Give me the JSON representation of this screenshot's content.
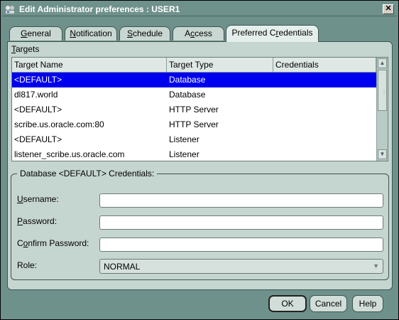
{
  "window": {
    "title": "Edit Administrator preferences : USER1",
    "close_glyph": "✕"
  },
  "tabs": [
    {
      "pre": "",
      "key": "G",
      "post": "eneral"
    },
    {
      "pre": "",
      "key": "N",
      "post": "otification"
    },
    {
      "pre": "",
      "key": "S",
      "post": "chedule"
    },
    {
      "pre": "A",
      "key": "c",
      "post": "cess"
    },
    {
      "pre": "Preferred C",
      "key": "r",
      "post": "edentials"
    }
  ],
  "active_tab_index": 4,
  "targets": {
    "label_key": "T",
    "label_rest": "argets",
    "columns": [
      "Target Name",
      "Target Type",
      "Credentials"
    ],
    "rows": [
      {
        "name": "<DEFAULT>",
        "type": "Database",
        "credentials": ""
      },
      {
        "name": "dl817.world",
        "type": "Database",
        "credentials": ""
      },
      {
        "name": "<DEFAULT>",
        "type": "HTTP Server",
        "credentials": ""
      },
      {
        "name": "scribe.us.oracle.com:80",
        "type": "HTTP Server",
        "credentials": ""
      },
      {
        "name": "<DEFAULT>",
        "type": "Listener",
        "credentials": ""
      },
      {
        "name": "listener_scribe.us.oracle.com",
        "type": "Listener",
        "credentials": ""
      }
    ],
    "selected_row_index": 0
  },
  "credentials": {
    "group_title": "Database <DEFAULT> Credentials:",
    "username": {
      "key": "U",
      "rest": "sername:",
      "value": ""
    },
    "password": {
      "key": "P",
      "rest": "assword:",
      "value": ""
    },
    "confirm": {
      "pre": "C",
      "key": "o",
      "rest": "nfirm Password:",
      "value": ""
    },
    "role": {
      "label": "Role:",
      "value": "NORMAL"
    }
  },
  "buttons": {
    "ok": "OK",
    "cancel": "Cancel",
    "help": "Help"
  },
  "colors": {
    "window_bg": "#6f918c",
    "panel_bg": "#c5d5d0",
    "selection": "#0000ee"
  },
  "icons": {
    "title": "app-icon",
    "close": "close-icon",
    "scroll_up": "scroll-up-arrow-icon",
    "scroll_down": "scroll-down-arrow-icon",
    "dropdown": "chevron-down-icon"
  }
}
